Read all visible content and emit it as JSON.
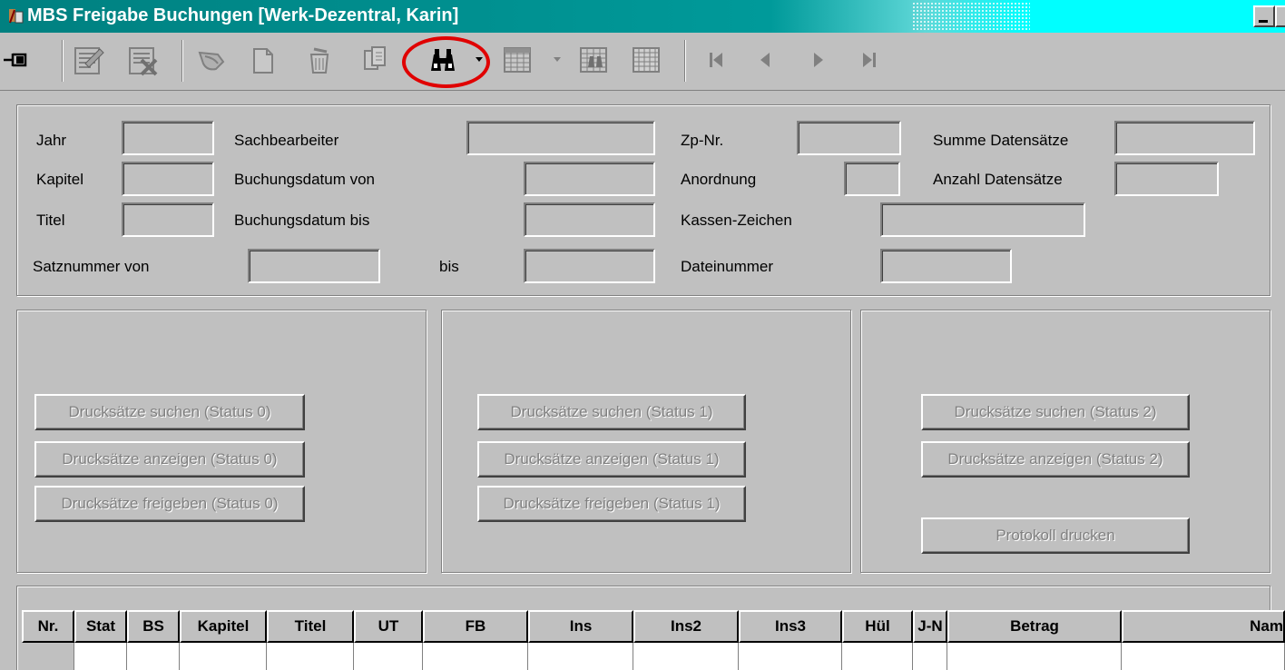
{
  "window": {
    "title": "MBS Freigabe Buchungen [Werk-Dezentral, Karin]"
  },
  "toolbar": {
    "icons": [
      "pin-icon",
      "edit-record-icon",
      "delete-record-icon",
      "undo-icon",
      "new-document-icon",
      "trash-icon",
      "copy-icon",
      "search-binoculars-icon",
      "grid-icon",
      "grid-search-icon",
      "table-icon",
      "first-record-icon",
      "previous-record-icon",
      "next-record-icon",
      "last-record-icon"
    ],
    "highlight_color": "#e00000"
  },
  "filters": {
    "jahr": "Jahr",
    "kapitel": "Kapitel",
    "titel": "Titel",
    "satznummer_von": "Satznummer von",
    "sachbearbeiter": "Sachbearbeiter",
    "buchungsdatum_von": "Buchungsdatum von",
    "buchungsdatum_bis": "Buchungsdatum bis",
    "bis": "bis",
    "zp_nr": "Zp-Nr.",
    "anordnung": "Anordnung",
    "kassen_zeichen": "Kassen-Zeichen",
    "dateinummer": "Dateinummer",
    "summe_datensaetze": "Summe Datensätze",
    "anzahl_datensaetze": "Anzahl Datensätze",
    "values": {
      "jahr": "",
      "kapitel": "",
      "titel": "",
      "satznummer_von": "",
      "satznummer_bis": "",
      "sachbearbeiter": "",
      "buchungsdatum_von": "",
      "buchungsdatum_bis": "",
      "zp_nr": "",
      "anordnung": "",
      "kassen_zeichen": "",
      "dateinummer": "",
      "summe_datensaetze": "",
      "anzahl_datensaetze": ""
    }
  },
  "groups": {
    "status0": {
      "suchen": "Drucksätze suchen (Status 0)",
      "anzeigen": "Drucksätze anzeigen (Status 0)",
      "freigeben": "Drucksätze freigeben (Status 0)"
    },
    "status1": {
      "suchen": "Drucksätze suchen (Status 1)",
      "anzeigen": "Drucksätze anzeigen (Status 1)",
      "freigeben": "Drucksätze freigeben (Status 1)"
    },
    "status2": {
      "suchen": "Drucksätze suchen (Status 2)",
      "anzeigen": "Drucksätze anzeigen (Status 2)",
      "protokoll": "Protokoll drucken"
    }
  },
  "grid": {
    "columns": [
      "Nr.",
      "Stat",
      "BS",
      "Kapitel",
      "Titel",
      "UT",
      "FB",
      "Ins",
      "Ins2",
      "Ins3",
      "Hül",
      "J-N",
      "Betrag",
      "Nam"
    ]
  }
}
